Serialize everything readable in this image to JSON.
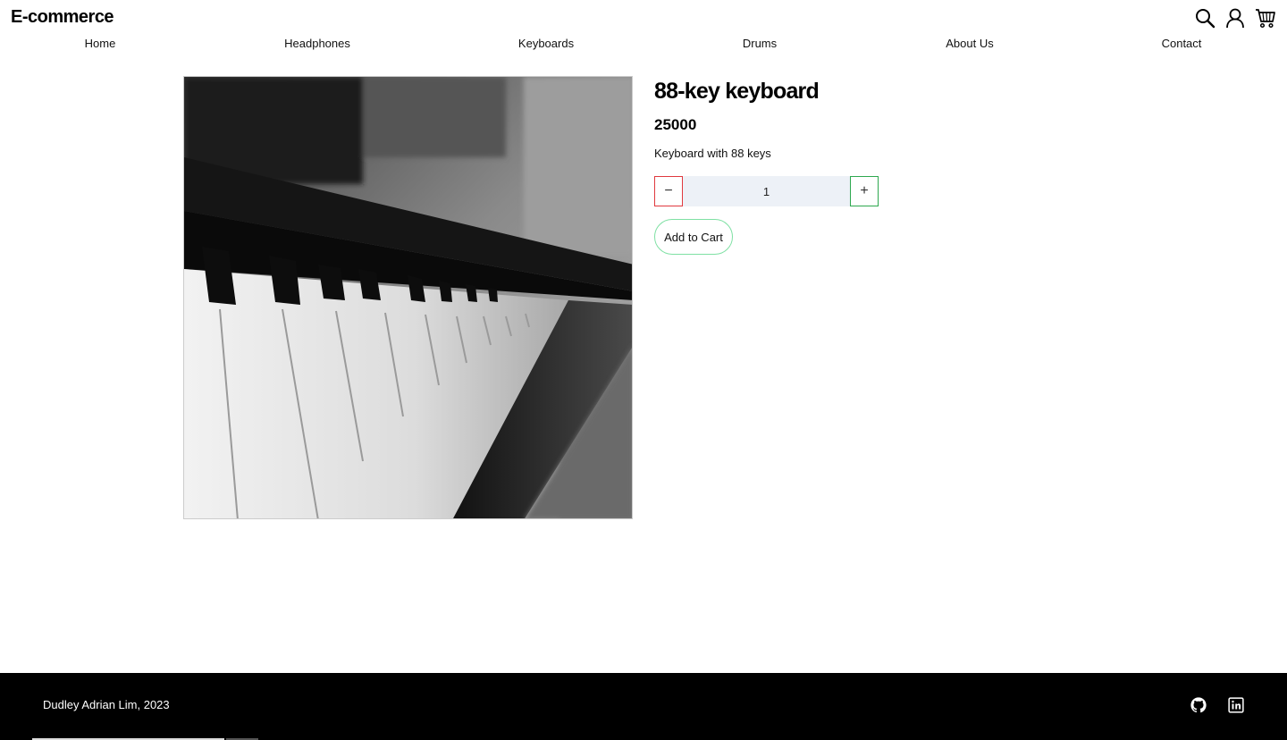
{
  "header": {
    "brand": "E-commerce",
    "icons": [
      "search-icon",
      "user-icon",
      "cart-icon"
    ]
  },
  "nav": {
    "items": [
      {
        "label": "Home"
      },
      {
        "label": "Headphones"
      },
      {
        "label": "Keyboards"
      },
      {
        "label": "Drums"
      },
      {
        "label": "About Us"
      },
      {
        "label": "Contact"
      }
    ]
  },
  "product": {
    "title": "88-key keyboard",
    "price": "25000",
    "description": "Keyboard with 88 keys",
    "quantity": "1",
    "minus_label": "−",
    "plus_label": "+",
    "add_to_cart_label": "Add to Cart",
    "image_subject": "piano-keys-photo"
  },
  "footer": {
    "text": "Dudley Adrian Lim, 2023",
    "icons": [
      "github-icon",
      "linkedin-icon"
    ]
  },
  "colors": {
    "minus_border": "#e0393e",
    "plus_border": "#2ea84f",
    "add_cart_border": "#7ee0a3",
    "qty_bg": "#edf1f7",
    "footer_bg": "#000000"
  }
}
